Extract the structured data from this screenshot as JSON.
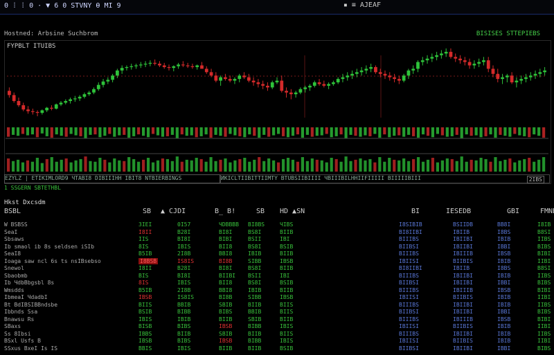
{
  "topbar": {
    "title": "0 ⁞ ⁞ 0 · ▼ 6 0 STVNY Ѳ MI 9",
    "menu": [
      "Stevar",
      "2",
      "PT",
      "SB"
    ],
    "icons": "▪ ≡ AJEAF"
  },
  "chart": {
    "title": "Hostned: Arbsine Suchbrom",
    "status": "BISISES STTEPIEBS",
    "label": "FYPBLT  ITUIBS",
    "info_left": "EZYLZ | ETIKIMLORD9 ЧTABI8 DIBIIIHH IBIT8 NTBIERBINGS",
    "info_right": "ИKICLTIIBITTIIMTY BTUBSIIBIIII ЧBIIIBILHHIIFIIIII BIIIIIBIII",
    "corner": "2IBS",
    "sub": "1 SSGERN SBTETHBL"
  },
  "chart_data": {
    "type": "candlestick",
    "series": [
      {
        "values": [
          [
            120,
            124,
            112,
            115
          ],
          [
            115,
            118,
            106,
            108
          ],
          [
            108,
            112,
            101,
            103
          ],
          [
            103,
            106,
            96,
            98
          ],
          [
            98,
            102,
            93,
            96
          ],
          [
            96,
            99,
            92,
            95
          ],
          [
            95,
            97,
            90,
            94
          ],
          [
            94,
            98,
            92,
            97
          ],
          [
            97,
            101,
            95,
            100
          ],
          [
            100,
            103,
            97,
            99
          ],
          [
            99,
            105,
            98,
            104
          ],
          [
            104,
            108,
            102,
            106
          ],
          [
            106,
            110,
            104,
            108
          ],
          [
            108,
            112,
            105,
            110
          ],
          [
            110,
            114,
            107,
            111
          ],
          [
            111,
            115,
            108,
            113
          ],
          [
            113,
            118,
            111,
            116
          ],
          [
            116,
            120,
            114,
            118
          ],
          [
            118,
            124,
            116,
            122
          ],
          [
            122,
            130,
            120,
            127
          ],
          [
            127,
            134,
            124,
            131
          ],
          [
            131,
            136,
            128,
            133
          ],
          [
            133,
            140,
            130,
            138
          ],
          [
            138,
            146,
            135,
            144
          ],
          [
            144,
            150,
            140,
            147
          ],
          [
            147,
            150,
            144,
            148
          ],
          [
            148,
            152,
            145,
            149
          ],
          [
            149,
            152,
            146,
            150
          ],
          [
            150,
            154,
            147,
            151
          ],
          [
            151,
            155,
            148,
            152
          ],
          [
            152,
            156,
            149,
            153
          ],
          [
            153,
            157,
            150,
            152
          ],
          [
            152,
            155,
            148,
            150
          ],
          [
            150,
            153,
            146,
            148
          ],
          [
            148,
            151,
            144,
            147
          ],
          [
            147,
            150,
            143,
            149
          ],
          [
            149,
            153,
            146,
            151
          ],
          [
            151,
            155,
            148,
            150
          ],
          [
            150,
            153,
            147,
            149
          ],
          [
            149,
            152,
            146,
            148
          ],
          [
            148,
            151,
            145,
            150
          ],
          [
            150,
            154,
            147,
            146
          ],
          [
            146,
            149,
            140,
            142
          ],
          [
            142,
            146,
            136,
            138
          ],
          [
            138,
            142,
            130,
            132
          ],
          [
            132,
            138,
            126,
            136
          ],
          [
            136,
            140,
            132,
            134
          ],
          [
            134,
            138,
            130,
            132
          ],
          [
            132,
            136,
            128,
            134
          ],
          [
            134,
            140,
            130,
            138
          ],
          [
            138,
            142,
            134,
            136
          ],
          [
            136,
            140,
            130,
            132
          ],
          [
            132,
            136,
            126,
            130
          ],
          [
            130,
            134,
            124,
            128
          ],
          [
            128,
            132,
            122,
            126
          ],
          [
            126,
            130,
            120,
            124
          ],
          [
            124,
            132,
            122,
            130
          ],
          [
            130,
            136,
            128,
            132
          ],
          [
            132,
            138,
            118,
            120
          ],
          [
            120,
            124,
            112,
            118
          ],
          [
            118,
            122,
            110,
            116
          ],
          [
            116,
            120,
            112,
            118
          ],
          [
            118,
            124,
            116,
            122
          ],
          [
            122,
            126,
            118,
            124
          ],
          [
            124,
            128,
            120,
            126
          ],
          [
            126,
            132,
            124,
            130
          ],
          [
            130,
            134,
            126,
            128
          ],
          [
            128,
            132,
            124,
            126
          ],
          [
            126,
            130,
            122,
            128
          ],
          [
            128,
            132,
            126,
            130
          ],
          [
            130,
            136,
            128,
            134
          ],
          [
            134,
            140,
            130,
            136
          ],
          [
            136,
            142,
            132,
            138
          ],
          [
            138,
            144,
            134,
            140
          ],
          [
            140,
            146,
            136,
            142
          ],
          [
            142,
            148,
            138,
            144
          ],
          [
            144,
            150,
            140,
            146
          ],
          [
            146,
            152,
            142,
            148
          ],
          [
            148,
            150,
            140,
            142
          ],
          [
            142,
            146,
            136,
            140
          ],
          [
            140,
            144,
            134,
            138
          ],
          [
            138,
            142,
            132,
            136
          ],
          [
            136,
            140,
            130,
            134
          ],
          [
            134,
            138,
            128,
            132
          ],
          [
            132,
            140,
            130,
            138
          ],
          [
            138,
            146,
            134,
            144
          ],
          [
            144,
            150,
            140,
            146
          ],
          [
            146,
            156,
            142,
            154
          ],
          [
            154,
            160,
            150,
            156
          ],
          [
            156,
            162,
            152,
            158
          ],
          [
            158,
            164,
            154,
            160
          ],
          [
            160,
            166,
            156,
            162
          ],
          [
            162,
            168,
            158,
            164
          ],
          [
            164,
            170,
            160,
            166
          ],
          [
            166,
            170,
            158,
            160
          ],
          [
            160,
            164,
            154,
            158
          ],
          [
            158,
            162,
            152,
            156
          ],
          [
            156,
            160,
            150,
            154
          ],
          [
            154,
            158,
            146,
            150
          ],
          [
            150,
            156,
            146,
            152
          ],
          [
            152,
            158,
            148,
            154
          ],
          [
            154,
            160,
            150,
            156
          ],
          [
            156,
            160,
            142,
            146
          ],
          [
            146,
            150,
            136,
            140
          ],
          [
            140,
            146,
            130,
            134
          ],
          [
            134,
            140,
            128,
            136
          ],
          [
            136,
            140,
            130,
            138
          ],
          [
            138,
            142,
            128,
            130
          ],
          [
            130,
            136,
            124,
            132
          ],
          [
            132,
            138,
            128,
            134
          ],
          [
            134,
            140,
            130,
            136
          ],
          [
            136,
            142,
            132,
            138
          ],
          [
            138,
            144,
            134,
            140
          ],
          [
            140,
            146,
            136,
            142
          ],
          [
            142,
            148,
            138,
            144
          ]
        ]
      }
    ],
    "volume": [
      40,
      32,
      36,
      28,
      34,
      30,
      42,
      26,
      38,
      44,
      30,
      36,
      40,
      28,
      34,
      38,
      46,
      32,
      30,
      42,
      36,
      28,
      40,
      34,
      32,
      44,
      38,
      30,
      36,
      42,
      28,
      34,
      40,
      38,
      32,
      46,
      30,
      36,
      34,
      42,
      38,
      30,
      44,
      32,
      36,
      40,
      28,
      34,
      38,
      42,
      30,
      36,
      44,
      32,
      40,
      34,
      28,
      38,
      42,
      36,
      30,
      44,
      32,
      40,
      36,
      34,
      28,
      42,
      38,
      30,
      46,
      32,
      36,
      40,
      34,
      38,
      28,
      44,
      30,
      42,
      36,
      34,
      40,
      32,
      38,
      44,
      30,
      36,
      42,
      28,
      34,
      40,
      38,
      32,
      46,
      30,
      36,
      34,
      42,
      38,
      30,
      44,
      32,
      36,
      40,
      28,
      34,
      38,
      42,
      30,
      36,
      44
    ]
  },
  "section": {
    "title": "Hkst Dxcsdm"
  },
  "table": {
    "headers": [
      "BSBL",
      "SB",
      "▲ CJDI",
      "B_ B!",
      "SB",
      "HD  ▲SN",
      "BI",
      "IESEDB",
      "GBI",
      "FMNB"
    ],
    "rows": [
      {
        "name": "W BSBSS",
        "v": [
          "3IEI",
          "0I57",
          "ЧDBBBB",
          "BI8BS",
          "ЧIBS",
          "I8SIBIB",
          "BSIIDB",
          "BB8I",
          "I8IB"
        ]
      },
      {
        "name": "SeaI",
        "v": [
          "I8II",
          "B28I",
          "BI8I",
          "BS8I",
          "BIIB",
          "BI8IIBI",
          "IBIIB",
          "I8BS",
          "B8SI"
        ]
      },
      {
        "name": "Sbsaws",
        "v": [
          "IIS",
          "BI8I",
          "BIBI",
          "BSII",
          "IBI",
          "BIIIBS",
          "IBIIBI",
          "IBIB",
          "IIBS"
        ]
      },
      {
        "name": "Ib smaol ib 8s seldsen iSIb",
        "v": [
          "8IS",
          "IBIS",
          "BII8",
          "BS8I",
          "BSIB",
          "BIIBSI",
          "IBIIBI",
          "IBBI",
          "BIBS"
        ]
      },
      {
        "name": "SeaI8",
        "v": [
          "B5IB",
          "2I8B",
          "BBI8",
          "IBIB",
          "BIIB",
          "BIIIBS",
          "IBIIIB",
          "IBSB",
          "BIBI"
        ]
      },
      {
        "name": "Ioaga saw ncl 6s ts nsIBsebso",
        "v": [
          "I8BSB",
          "IS8IS",
          "BI8B",
          "SIBB",
          "IBSB",
          "IBIISI",
          "BIIBIS",
          "IBIB",
          "IIBI"
        ]
      },
      {
        "name": "Snewol",
        "v": [
          "I8II",
          "B28I",
          "BI8I",
          "BS8I",
          "BIIB",
          "BI8IIBI",
          "IBIIB",
          "I8BS",
          "B8SI"
        ]
      },
      {
        "name": "Sbaobmb",
        "v": [
          "BIS",
          "BI8I",
          "ВIIBI",
          "BSII",
          "IBI",
          "BIIIBS",
          "IBIIBI",
          "IBIB",
          "IIBS"
        ]
      },
      {
        "name": "Ib ЧdbBbgsbl 8s",
        "v": [
          "8IS",
          "IBIS",
          "BII8",
          "BS8I",
          "BSIB",
          "BIIBSI",
          "IBIIBI",
          "IBBI",
          "BIBS"
        ]
      },
      {
        "name": "Wmsdds",
        "v": [
          "B5IB",
          "2I8B",
          "BBI8",
          "IBIB",
          "BIIB",
          "BIIIBS",
          "IBIIIB",
          "IBSB",
          "BIBI"
        ]
      },
      {
        "name": "IbmeaI ЧdadbI",
        "v": [
          "IBSB",
          "IS8IS",
          "BI8B",
          "SIBB",
          "IBSB",
          "IBIISI",
          "BIIBIS",
          "IBIB",
          "IIBI"
        ]
      },
      {
        "name": "Bt BdIBSIBBndsbe",
        "v": [
          "BIIS",
          "BBIB",
          "SBIB",
          "BIIB",
          "BIIS",
          "BIIIBS",
          "IBIIBI",
          "IBIB",
          "IIBS"
        ]
      },
      {
        "name": "Ibbnds Ssa",
        "v": [
          "BSIB",
          "BIBB",
          "BIBS",
          "BBIB",
          "BIIS",
          "BIIBSI",
          "IBIIBI",
          "IBBI",
          "BIBS"
        ]
      },
      {
        "name": "Bnawsu Rs",
        "v": [
          "IBIS",
          "IBIB",
          "BIIB",
          "SBIB",
          "BIIB",
          "BIIIBS",
          "IBIIIB",
          "IBSB",
          "BIBI"
        ]
      },
      {
        "name": "SBaxs",
        "v": [
          "BISB",
          "BIBS",
          "IBSB",
          "BIBB",
          "IBIS",
          "IBIISI",
          "BIIBIS",
          "IBIB",
          "IIBI"
        ]
      },
      {
        "name": "Ss 8Ibsi",
        "v": [
          "IBBS",
          "BIIB",
          "SBIB",
          "BIIB",
          "BIIS",
          "BIIIBS",
          "IBIIBI",
          "IBIB",
          "IIBS"
        ]
      },
      {
        "name": "BSxl Usfs B",
        "v": [
          "IBSB",
          "BIBS",
          "IBSB",
          "BIBB",
          "IBIS",
          "IBIISI",
          "BIIBIS",
          "IBIB",
          "IIBI"
        ]
      },
      {
        "name": "SSxus BxeI Is IS",
        "v": [
          "BBIS",
          "IBIS",
          "BIIB",
          "BIIB",
          "BSIB",
          "BIIBSI",
          "IBIIBI",
          "IBBI",
          "BIBS"
        ]
      }
    ],
    "red_cells": [
      [
        1,
        0
      ],
      [
        5,
        0
      ],
      [
        5,
        1
      ],
      [
        5,
        2
      ],
      [
        8,
        0
      ],
      [
        10,
        0
      ],
      [
        14,
        2
      ],
      [
        16,
        2
      ]
    ],
    "redbg_cells": [
      [
        5,
        0
      ]
    ]
  },
  "colors": {
    "up": "#2ec23a",
    "down": "#d42a2a",
    "bg": "#000000",
    "accent_blue": "#5a78d8"
  }
}
